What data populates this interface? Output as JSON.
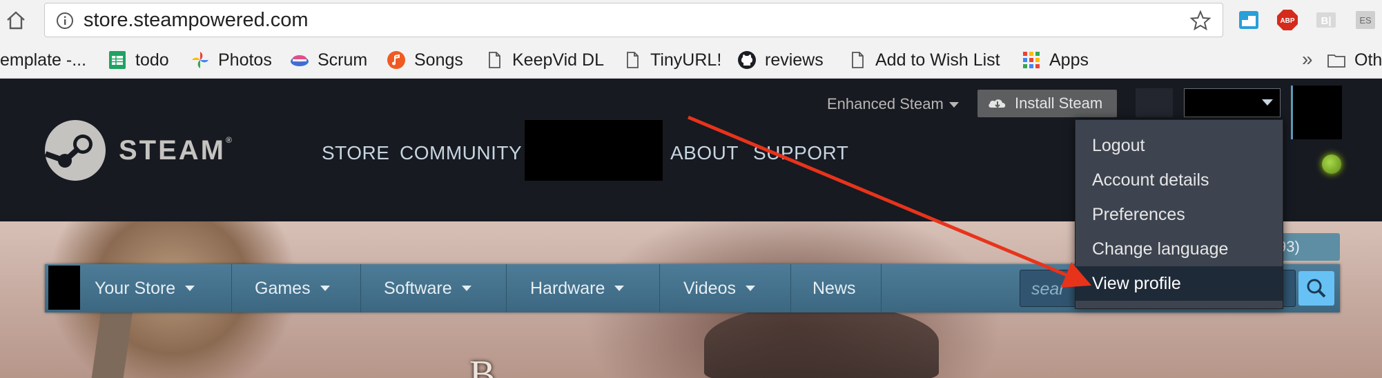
{
  "browser": {
    "url": "store.steampowered.com",
    "bookmarks": [
      {
        "label": "emplate -...",
        "icon": "bookmark-icon"
      },
      {
        "label": "todo",
        "icon": "sheets-icon"
      },
      {
        "label": "Photos",
        "icon": "photos-icon"
      },
      {
        "label": "Scrum",
        "icon": "scrum-icon"
      },
      {
        "label": "Songs",
        "icon": "music-icon"
      },
      {
        "label": "KeepVid DL",
        "icon": "page-icon"
      },
      {
        "label": "TinyURL!",
        "icon": "page-icon"
      },
      {
        "label": "reviews",
        "icon": "github-icon"
      },
      {
        "label": "Add to Wish List",
        "icon": "page-icon"
      },
      {
        "label": "Apps",
        "icon": "apps-grid-icon"
      }
    ],
    "bookmarks_overflow": "»",
    "other_bookmarks": "Oth",
    "extensions": {
      "abp": "ABP",
      "bl": "B|",
      "es": "ES"
    }
  },
  "steam_header": {
    "wordmark": "STEAM",
    "registered": "®",
    "nav": [
      "STORE",
      "COMMUNITY",
      "ABOUT",
      "SUPPORT"
    ],
    "enhanced_steam": "Enhanced Steam",
    "install_steam": "Install Steam"
  },
  "account_menu": {
    "items": [
      "Logout",
      "Account details",
      "Preferences",
      "Change language",
      "View profile"
    ],
    "hover_index": 4
  },
  "store_nav": {
    "tabs": [
      "Your Store",
      "Games",
      "Software",
      "Hardware",
      "Videos",
      "News"
    ],
    "search_placeholder": "sear",
    "wishlist_fragment": "93)"
  },
  "banner": {
    "title_fragment": "B"
  },
  "colors": {
    "steam_header_bg": "#171a21",
    "store_nav_bg": "#4d7c98",
    "menu_bg": "#3d4450",
    "menu_hover": "#1f2a38",
    "arrow": "#e8331b",
    "online": "#a4d007"
  }
}
